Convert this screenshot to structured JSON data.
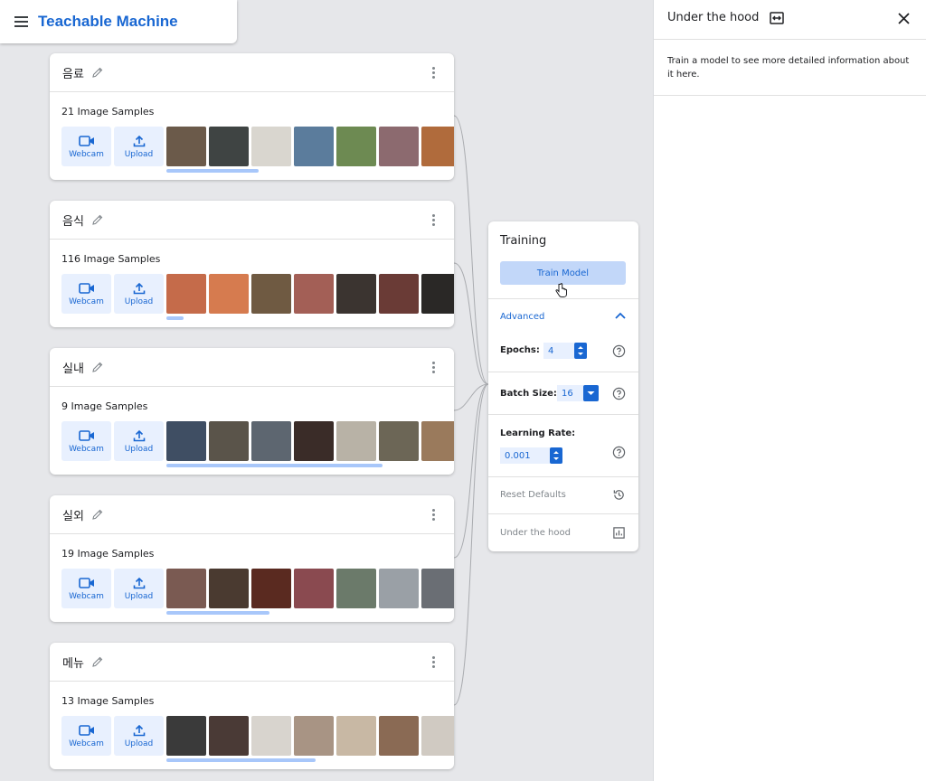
{
  "app": {
    "title": "Teachable Machine"
  },
  "classes": [
    {
      "name": "음료",
      "samples_label": "21 Image Samples",
      "scroll_fraction": 0.32,
      "thumbs": [
        "#6b5a4a",
        "#3f4443",
        "#d9d6cf",
        "#5b7c9c",
        "#6d8a52",
        "#8c6a6f",
        "#b06b3c",
        "#c6c0b6"
      ]
    },
    {
      "name": "음식",
      "samples_label": "116 Image Samples",
      "scroll_fraction": 0.06,
      "thumbs": [
        "#c56b4a",
        "#d67b4f",
        "#6f5a42",
        "#a35f56",
        "#3b3430",
        "#6a3b36",
        "#2a2826",
        "#8a6b3e"
      ]
    },
    {
      "name": "실내",
      "samples_label": "9 Image Samples",
      "scroll_fraction": 0.75,
      "thumbs": [
        "#3f4e63",
        "#5a544a",
        "#5d6670",
        "#3a2c28",
        "#b8b2a6",
        "#6c6656",
        "#9a7a5c",
        "#6f5f4a"
      ]
    },
    {
      "name": "실외",
      "samples_label": "19 Image Samples",
      "scroll_fraction": 0.36,
      "thumbs": [
        "#7a5a52",
        "#4a3a30",
        "#5a2a20",
        "#8a4a50",
        "#6b7a6a",
        "#9aa0a6",
        "#6a6e74",
        "#8a8e92"
      ]
    },
    {
      "name": "메뉴",
      "samples_label": "13 Image Samples",
      "scroll_fraction": 0.52,
      "thumbs": [
        "#3a3a3a",
        "#4a3a36",
        "#d8d4ce",
        "#a89484",
        "#c8b8a4",
        "#8a6a54",
        "#d0cac2",
        "#c8a8a2"
      ]
    }
  ],
  "buttons": {
    "webcam": "Webcam",
    "upload": "Upload"
  },
  "training": {
    "title": "Training",
    "train_button": "Train Model",
    "advanced": "Advanced",
    "epochs_label": "Epochs:",
    "epochs_value": "4",
    "batch_label": "Batch Size:",
    "batch_value": "16",
    "lr_label": "Learning Rate:",
    "lr_value": "0.001",
    "reset_label": "Reset Defaults",
    "hood_label": "Under the hood"
  },
  "hood_panel": {
    "title": "Under the hood",
    "description": "Train a model to see more detailed information about it here."
  },
  "colors": {
    "accent": "#1967d2",
    "accent_light": "#e8f0fe",
    "button_fill": "#c2d7f9"
  }
}
